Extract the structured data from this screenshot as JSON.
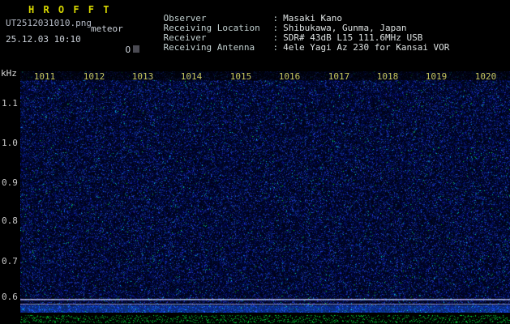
{
  "app": {
    "title": "H R O F F T",
    "filename": "UT2512031010.png",
    "comment": "meteor",
    "datetime": "25.12.03 10:10",
    "status": "O"
  },
  "header": {
    "separator": ":",
    "rows": [
      {
        "label": "Observer",
        "value": "Masaki Kano"
      },
      {
        "label": "Receiving Location",
        "value": "Shibukawa, Gunma, Japan"
      },
      {
        "label": "Receiver",
        "value": "SDR# 43dB L15 111.6MHz USB"
      },
      {
        "label": "Receiving Antenna",
        "value": "4ele Yagi Az 230 for Kansai VOR"
      }
    ]
  },
  "spectrogram": {
    "y_axis_unit": "kHz",
    "freq_labels": [
      "1.1",
      "1.0",
      "0.9",
      "0.8",
      "0.7",
      "0.6"
    ],
    "time_labels": [
      "1011",
      "1012",
      "1013",
      "1014",
      "1015",
      "1016",
      "1017",
      "1018",
      "1019",
      "1020"
    ]
  },
  "colors": {
    "title_yellow": "#d8d800",
    "header_text": "#dde2e2",
    "time_label_yellow": "#c8c860",
    "freq_label": "#c8c8c8",
    "noise_base": "#000020",
    "noise_speckle_blue": "#2a3ed0",
    "carrier_line": "#c8d0e8",
    "level_green": "#00c832"
  },
  "chart_data": {
    "type": "heatmap",
    "title": "",
    "xlabel": "",
    "ylabel": "kHz",
    "x_tick_labels": [
      "1011",
      "1012",
      "1013",
      "1014",
      "1015",
      "1016",
      "1017",
      "1018",
      "1019",
      "1020"
    ],
    "y_tick_labels": [
      1.1,
      1.0,
      0.9,
      0.8,
      0.7,
      0.6
    ],
    "ylim": [
      0.57,
      1.18
    ],
    "grid": false,
    "legend": false,
    "annotations": [
      "blue background noise field only; no meteor echo traces visible",
      "two continuous horizontal carrier lines just below the 0.6 kHz tick",
      "brighter noise band along the bottom edge of the spectrogram",
      "green random signal-level noise strip along the very bottom of the image"
    ]
  }
}
